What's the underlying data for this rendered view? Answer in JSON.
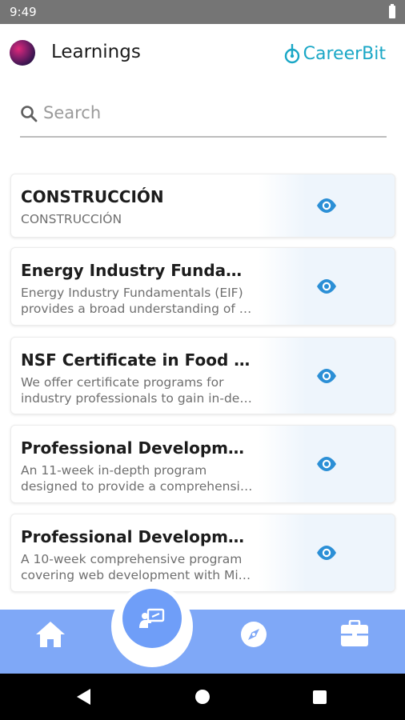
{
  "status_bar": {
    "time": "9:49"
  },
  "app_bar": {
    "title": "Learnings",
    "brand": "CareerBit",
    "brand_color": "#1aa7c6"
  },
  "search": {
    "placeholder": "Search"
  },
  "courses": [
    {
      "title": "CONSTRUCCIÓN",
      "description": [
        "CONSTRUCCIÓN"
      ]
    },
    {
      "title": "Energy Industry Fundamentals",
      "description": [
        "Energy Industry Fundamentals (EIF)",
        "provides a broad understanding of the"
      ]
    },
    {
      "title": "NSF Certificate in Food Safety",
      "description": [
        "We offer certificate programs for",
        "industry professionals to gain in-depth"
      ]
    },
    {
      "title": "Professional Development Program",
      "description": [
        "An 11-week in-depth program",
        "designed to provide a comprehensive"
      ]
    },
    {
      "title": "Professional Development Program",
      "description": [
        "A 10-week comprehensive program",
        "covering web development with Microsoft"
      ]
    }
  ],
  "bottom_nav": {
    "items": [
      "home-icon",
      "learning-icon",
      "compass-icon",
      "briefcase-icon"
    ],
    "color": "#7fa8f7",
    "active_color": "#6f9ef8"
  },
  "theme": {
    "view_icon_color": "#2b8fd6"
  }
}
